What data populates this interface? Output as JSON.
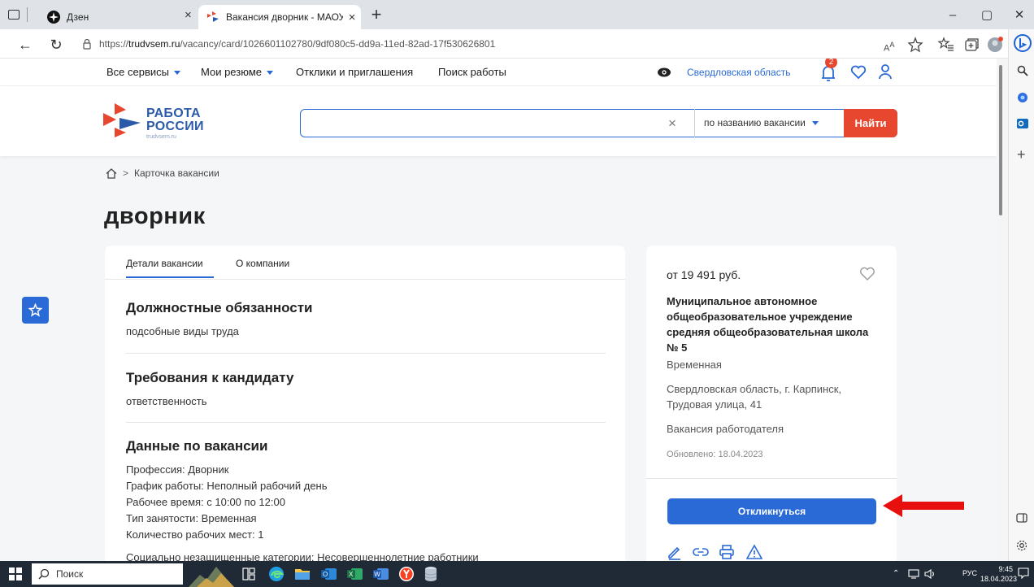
{
  "browser": {
    "tabs": [
      {
        "title": "Дзен"
      },
      {
        "title": "Вакансия дворник - МАОУ СОШ"
      }
    ],
    "url_prefix": "https://",
    "url_domain": "trudvsem.ru",
    "url_path": "/vacancy/card/1026601102780/9df080c5-dd9a-11ed-82ad-17f530626801"
  },
  "topnav": {
    "services": "Все сервисы",
    "resumes": "Мои резюме",
    "responses": "Отклики и приглашения",
    "job_search": "Поиск работы",
    "region": "Свердловская область",
    "notification_count": "2"
  },
  "header": {
    "logo_line1": "РАБОТА",
    "logo_line2": "РОССИИ",
    "logo_sub": "trudvsem.ru",
    "search_value": "",
    "search_mode": "по названию вакансии",
    "search_button": "Найти"
  },
  "breadcrumb": {
    "separator": ">",
    "current": "Карточка вакансии"
  },
  "vacancy": {
    "title": "дворник",
    "tabs": [
      "Детали вакансии",
      "О компании"
    ],
    "duties_heading": "Должностные обязанности",
    "duties_text": "подсобные виды труда",
    "requirements_heading": "Требования к кандидату",
    "requirements_text": "ответственность",
    "data_heading": "Данные по вакансии",
    "data_lines": [
      "Профессия: Дворник",
      "График работы: Неполный рабочий день",
      "Рабочее время: с 10:00 по 12:00",
      "Тип занятости: Временная",
      "Количество рабочих мест: 1"
    ],
    "social_line": "Социально незащищенные категории: Несовершеннолетние работники"
  },
  "sidebar": {
    "salary": "от 19 491 руб.",
    "employer": "Муниципальное автономное общеобразовательное учреждение средняя общеобразовательная школа № 5",
    "employment": "Временная",
    "address": "Свердловская область, г. Карпинск, Трудовая улица, 41",
    "vacancy_type": "Вакансия работодателя",
    "updated": "Обновлено: 18.04.2023",
    "apply_button": "Откликнуться"
  },
  "taskbar": {
    "search": "Поиск",
    "lang": "РУС",
    "time": "9:45",
    "date": "18.04.2023"
  },
  "colors": {
    "accent": "#2a6ad6",
    "brand_red": "#e8472f",
    "arrow": "#e8100f"
  }
}
